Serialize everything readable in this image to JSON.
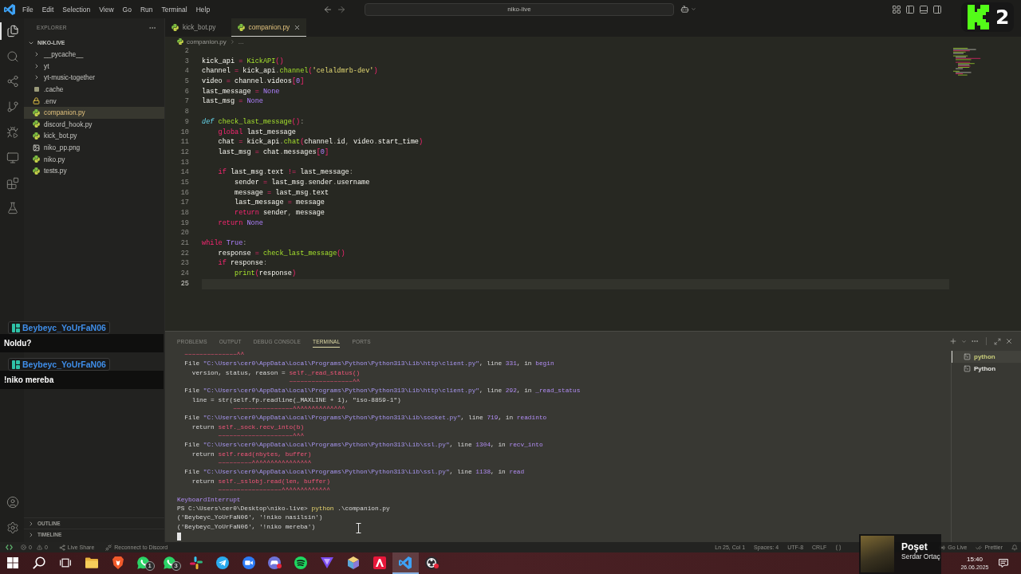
{
  "title_bar": {
    "menu": [
      "File",
      "Edit",
      "Selection",
      "View",
      "Go",
      "Run",
      "Terminal",
      "Help"
    ],
    "search": "niko-live"
  },
  "overlay_badge": {
    "count": "2"
  },
  "activity_bar": {
    "items": [
      {
        "kind": "files",
        "selected": true
      },
      {
        "kind": "search",
        "selected": false
      },
      {
        "kind": "share",
        "selected": false
      },
      {
        "kind": "branch",
        "selected": false
      },
      {
        "kind": "debug",
        "selected": false
      },
      {
        "kind": "remote",
        "selected": false
      },
      {
        "kind": "blocks",
        "selected": false
      },
      {
        "kind": "flask",
        "selected": false
      }
    ],
    "bottom": [
      {
        "kind": "account"
      },
      {
        "kind": "gear"
      }
    ]
  },
  "sidebar": {
    "title": "EXPLORER",
    "folder": "NIKO-LIVE",
    "items": [
      {
        "name": "__pycache__",
        "kind": "folder",
        "selected": false
      },
      {
        "name": "yt",
        "kind": "folder",
        "selected": false
      },
      {
        "name": "yt-music-together",
        "kind": "folder",
        "selected": false
      },
      {
        "name": ".cache",
        "kind": "cache",
        "selected": false
      },
      {
        "name": ".env",
        "kind": "lock",
        "selected": false
      },
      {
        "name": "companion.py",
        "kind": "python",
        "selected": true
      },
      {
        "name": "discord_hook.py",
        "kind": "python",
        "selected": false
      },
      {
        "name": "kick_bot.py",
        "kind": "python",
        "selected": false
      },
      {
        "name": "niko_pp.png",
        "kind": "image",
        "selected": false
      },
      {
        "name": "niko.py",
        "kind": "python",
        "selected": false
      },
      {
        "name": "tests.py",
        "kind": "python",
        "selected": false
      }
    ],
    "sections": [
      "OUTLINE",
      "TIMELINE"
    ]
  },
  "tabs": [
    {
      "label": "kick_bot.py",
      "selected": false
    },
    {
      "label": "companion.py",
      "selected": true
    }
  ],
  "breadcrumb": [
    "companion.py",
    "..."
  ],
  "editor": {
    "lines": [
      {
        "number": "2",
        "current": false
      },
      {
        "number": "3",
        "current": false,
        "tokens": [
          {
            "text": "kick_api ",
            "kind": "plain"
          },
          {
            "text": "= ",
            "kind": "kw"
          },
          {
            "text": "KickAPI",
            "kind": "fn"
          },
          {
            "text": "()",
            "kind": "kw"
          }
        ]
      },
      {
        "number": "4",
        "current": false,
        "tokens": [
          {
            "text": "channel ",
            "kind": "plain"
          },
          {
            "text": "= ",
            "kind": "kw"
          },
          {
            "text": "kick_api",
            "kind": "plain"
          },
          {
            "text": ".",
            "kind": "dim"
          },
          {
            "text": "channel",
            "kind": "fn"
          },
          {
            "text": "(",
            "kind": "kw"
          },
          {
            "text": "'celaldmrb-dev'",
            "kind": "str"
          },
          {
            "text": ")",
            "kind": "kw"
          }
        ]
      },
      {
        "number": "5",
        "current": false,
        "tokens": [
          {
            "text": "video ",
            "kind": "plain"
          },
          {
            "text": "= ",
            "kind": "kw"
          },
          {
            "text": "channel",
            "kind": "plain"
          },
          {
            "text": ".",
            "kind": "dim"
          },
          {
            "text": "videos",
            "kind": "plain"
          },
          {
            "text": "[",
            "kind": "kw"
          },
          {
            "text": "0",
            "kind": "const"
          },
          {
            "text": "]",
            "kind": "kw"
          }
        ]
      },
      {
        "number": "6",
        "current": false,
        "tokens": [
          {
            "text": "last_message ",
            "kind": "plain"
          },
          {
            "text": "= ",
            "kind": "kw"
          },
          {
            "text": "None",
            "kind": "const"
          }
        ]
      },
      {
        "number": "7",
        "current": false,
        "tokens": [
          {
            "text": "last_msg ",
            "kind": "plain"
          },
          {
            "text": "= ",
            "kind": "kw"
          },
          {
            "text": "None",
            "kind": "const"
          }
        ]
      },
      {
        "number": "8",
        "current": false
      },
      {
        "number": "9",
        "current": false,
        "tokens": [
          {
            "text": "def ",
            "kind": "def"
          },
          {
            "text": "check_last_message",
            "kind": "fn"
          },
          {
            "text": "()",
            "kind": "kw"
          },
          {
            "text": ":",
            "kind": "dim"
          }
        ]
      },
      {
        "number": "10",
        "current": false,
        "tokens": [
          {
            "text": "    global ",
            "kind": "kw"
          },
          {
            "text": "last_message",
            "kind": "plain"
          }
        ]
      },
      {
        "number": "11",
        "current": false,
        "tokens": [
          {
            "text": "    chat ",
            "kind": "plain"
          },
          {
            "text": "= ",
            "kind": "kw"
          },
          {
            "text": "kick_api",
            "kind": "plain"
          },
          {
            "text": ".",
            "kind": "dim"
          },
          {
            "text": "chat",
            "kind": "fn"
          },
          {
            "text": "(",
            "kind": "kw"
          },
          {
            "text": "channel",
            "kind": "plain"
          },
          {
            "text": ".",
            "kind": "dim"
          },
          {
            "text": "id",
            "kind": "plain"
          },
          {
            "text": ", ",
            "kind": "dim"
          },
          {
            "text": "video",
            "kind": "plain"
          },
          {
            "text": ".",
            "kind": "dim"
          },
          {
            "text": "start_time",
            "kind": "plain"
          },
          {
            "text": ")",
            "kind": "kw"
          }
        ]
      },
      {
        "number": "12",
        "current": false,
        "tokens": [
          {
            "text": "    last_msg ",
            "kind": "plain"
          },
          {
            "text": "= ",
            "kind": "kw"
          },
          {
            "text": "chat",
            "kind": "plain"
          },
          {
            "text": ".",
            "kind": "dim"
          },
          {
            "text": "messages",
            "kind": "plain"
          },
          {
            "text": "[",
            "kind": "kw"
          },
          {
            "text": "0",
            "kind": "const"
          },
          {
            "text": "]",
            "kind": "kw"
          }
        ]
      },
      {
        "number": "13",
        "current": false
      },
      {
        "number": "14",
        "current": false,
        "tokens": [
          {
            "text": "    if ",
            "kind": "kw"
          },
          {
            "text": "last_msg",
            "kind": "plain"
          },
          {
            "text": ".",
            "kind": "dim"
          },
          {
            "text": "text ",
            "kind": "plain"
          },
          {
            "text": "!= ",
            "kind": "kw"
          },
          {
            "text": "last_message",
            "kind": "plain"
          },
          {
            "text": ":",
            "kind": "dim"
          }
        ]
      },
      {
        "number": "15",
        "current": false,
        "tokens": [
          {
            "text": "        sender ",
            "kind": "plain"
          },
          {
            "text": "= ",
            "kind": "kw"
          },
          {
            "text": "last_msg",
            "kind": "plain"
          },
          {
            "text": ".",
            "kind": "dim"
          },
          {
            "text": "sender",
            "kind": "plain"
          },
          {
            "text": ".",
            "kind": "dim"
          },
          {
            "text": "username",
            "kind": "plain"
          }
        ]
      },
      {
        "number": "16",
        "current": false,
        "tokens": [
          {
            "text": "        message ",
            "kind": "plain"
          },
          {
            "text": "= ",
            "kind": "kw"
          },
          {
            "text": "last_msg",
            "kind": "plain"
          },
          {
            "text": ".",
            "kind": "dim"
          },
          {
            "text": "text",
            "kind": "plain"
          }
        ]
      },
      {
        "number": "17",
        "current": false,
        "tokens": [
          {
            "text": "        last_message ",
            "kind": "plain"
          },
          {
            "text": "= ",
            "kind": "kw"
          },
          {
            "text": "message",
            "kind": "plain"
          }
        ]
      },
      {
        "number": "18",
        "current": false,
        "tokens": [
          {
            "text": "        return ",
            "kind": "kw"
          },
          {
            "text": "sender",
            "kind": "plain"
          },
          {
            "text": ", ",
            "kind": "dim"
          },
          {
            "text": "message",
            "kind": "plain"
          }
        ]
      },
      {
        "number": "19",
        "current": false,
        "tokens": [
          {
            "text": "    return ",
            "kind": "kw"
          },
          {
            "text": "None",
            "kind": "const"
          }
        ]
      },
      {
        "number": "20",
        "current": false
      },
      {
        "number": "21",
        "current": false,
        "tokens": [
          {
            "text": "while ",
            "kind": "kw"
          },
          {
            "text": "True",
            "kind": "const"
          },
          {
            "text": ":",
            "kind": "dim"
          }
        ]
      },
      {
        "number": "22",
        "current": false,
        "tokens": [
          {
            "text": "    response ",
            "kind": "plain"
          },
          {
            "text": "= ",
            "kind": "kw"
          },
          {
            "text": "check_last_message",
            "kind": "fn"
          },
          {
            "text": "()",
            "kind": "kw"
          }
        ]
      },
      {
        "number": "23",
        "current": false,
        "tokens": [
          {
            "text": "    if ",
            "kind": "kw"
          },
          {
            "text": "response",
            "kind": "plain"
          },
          {
            "text": ":",
            "kind": "dim"
          }
        ]
      },
      {
        "number": "24",
        "current": false,
        "tokens": [
          {
            "text": "        print",
            "kind": "fn"
          },
          {
            "text": "(",
            "kind": "kw"
          },
          {
            "text": "response",
            "kind": "plain"
          },
          {
            "text": ")",
            "kind": "kw"
          }
        ]
      },
      {
        "number": "25",
        "current": true
      }
    ]
  },
  "panel": {
    "tabs": [
      {
        "label": "PROBLEMS",
        "selected": false
      },
      {
        "label": "OUTPUT",
        "selected": false
      },
      {
        "label": "DEBUG CONSOLE",
        "selected": false
      },
      {
        "label": "TERMINAL",
        "selected": true
      },
      {
        "label": "PORTS",
        "selected": false
      }
    ],
    "terminal": {
      "lines": [
        [
          {
            "text": "  ~~~~~~~~~~~~~~^^",
            "kind": "err"
          }
        ],
        [
          {
            "text": "  File ",
            "kind": "plain"
          },
          {
            "text": "\"C:\\Users\\cer0\\AppData\\Local\\Programs\\Python\\Python313\\Lib\\http\\client.py\"",
            "kind": "path"
          },
          {
            "text": ", line ",
            "kind": "plain"
          },
          {
            "text": "331",
            "kind": "name"
          },
          {
            "text": ", in ",
            "kind": "plain"
          },
          {
            "text": "begin",
            "kind": "name"
          }
        ],
        [
          {
            "text": "    version, status, reason = ",
            "kind": "plain"
          },
          {
            "text": "self._read_status()",
            "kind": "err"
          }
        ],
        [
          {
            "text": "                              ~~~~~~~~~~~~~~~~~^^",
            "kind": "err"
          }
        ],
        [
          {
            "text": "  File ",
            "kind": "plain"
          },
          {
            "text": "\"C:\\Users\\cer0\\AppData\\Local\\Programs\\Python\\Python313\\Lib\\http\\client.py\"",
            "kind": "path"
          },
          {
            "text": ", line ",
            "kind": "plain"
          },
          {
            "text": "292",
            "kind": "name"
          },
          {
            "text": ", in ",
            "kind": "plain"
          },
          {
            "text": "_read_status",
            "kind": "name"
          }
        ],
        [
          {
            "text": "    line = str(self.fp.readline(_MAXLINE + 1), \"iso-8859-1\")",
            "kind": "plain"
          }
        ],
        [
          {
            "text": "               ~~~~~~~~~~~~~~~~^^^^^^^^^^^^^^",
            "kind": "err"
          }
        ],
        [
          {
            "text": "  File ",
            "kind": "plain"
          },
          {
            "text": "\"C:\\Users\\cer0\\AppData\\Local\\Programs\\Python\\Python313\\Lib\\socket.py\"",
            "kind": "path"
          },
          {
            "text": ", line ",
            "kind": "plain"
          },
          {
            "text": "719",
            "kind": "name"
          },
          {
            "text": ", in ",
            "kind": "plain"
          },
          {
            "text": "readinto",
            "kind": "name"
          }
        ],
        [
          {
            "text": "    return ",
            "kind": "plain"
          },
          {
            "text": "self._sock.recv_into(b)",
            "kind": "err"
          }
        ],
        [
          {
            "text": "           ~~~~~~~~~~~~~~~~~~~~^^^",
            "kind": "err"
          }
        ],
        [
          {
            "text": "  File ",
            "kind": "plain"
          },
          {
            "text": "\"C:\\Users\\cer0\\AppData\\Local\\Programs\\Python\\Python313\\Lib\\ssl.py\"",
            "kind": "path"
          },
          {
            "text": ", line ",
            "kind": "plain"
          },
          {
            "text": "1304",
            "kind": "name"
          },
          {
            "text": ", in ",
            "kind": "plain"
          },
          {
            "text": "recv_into",
            "kind": "name"
          }
        ],
        [
          {
            "text": "    return ",
            "kind": "plain"
          },
          {
            "text": "self.read(nbytes, buffer)",
            "kind": "err"
          }
        ],
        [
          {
            "text": "           ~~~~~~~~~^^^^^^^^^^^^^^^^",
            "kind": "err"
          }
        ],
        [
          {
            "text": "  File ",
            "kind": "plain"
          },
          {
            "text": "\"C:\\Users\\cer0\\AppData\\Local\\Programs\\Python\\Python313\\Lib\\ssl.py\"",
            "kind": "path"
          },
          {
            "text": ", line ",
            "kind": "plain"
          },
          {
            "text": "1138",
            "kind": "name"
          },
          {
            "text": ", in ",
            "kind": "plain"
          },
          {
            "text": "read",
            "kind": "name"
          }
        ],
        [
          {
            "text": "    return ",
            "kind": "plain"
          },
          {
            "text": "self._sslobj.read(len, buffer)",
            "kind": "err"
          }
        ],
        [
          {
            "text": "           ~~~~~~~~~~~~~~~~~^^^^^^^^^^^^^",
            "kind": "err"
          }
        ],
        [
          {
            "text": "KeyboardInterrupt",
            "kind": "name"
          }
        ],
        [
          {
            "text": "PS C:\\Users\\cer0\\Desktop\\niko-live> ",
            "kind": "plain"
          },
          {
            "text": "python",
            "kind": "cmd"
          },
          {
            "text": " .\\companion.py",
            "kind": "plain"
          }
        ],
        [
          {
            "text": "('Beybeyc_YoUrFaN06', '!niko nasilsin')",
            "kind": "plain"
          }
        ],
        [
          {
            "text": "('Beybeyc_YoUrFaN06', '!niko mereba')",
            "kind": "plain"
          }
        ]
      ]
    },
    "sessions": [
      {
        "label": "python",
        "selected": true
      },
      {
        "label": "Python",
        "selected": false
      }
    ]
  },
  "chat_overlay": {
    "messages": [
      {
        "user": "Beybeyc_YoUrFaN06",
        "text": "Noldu?"
      },
      {
        "user": "Beybeyc_YoUrFaN06",
        "text": "!niko mereba"
      }
    ]
  },
  "status_bar": {
    "errors": "0",
    "warnings": "0",
    "left": [
      {
        "label": "Live Share",
        "kind": "share"
      },
      {
        "label": "Reconnect to Discord",
        "kind": "plug"
      }
    ],
    "right": [
      "Ln 25, Col 1",
      "Spaces: 4",
      "UTF-8",
      "CRLF"
    ],
    "extras": [
      {
        "label": "Go Live",
        "kind": "broadcast"
      },
      {
        "label": "Prettier",
        "kind": "checks"
      }
    ]
  },
  "now_playing": {
    "title": "Poşet",
    "artist": "Serdar Ortaç"
  },
  "taskbar": {
    "apps": [
      {
        "kind": "start",
        "selected": false,
        "alert": false
      },
      {
        "kind": "search",
        "selected": false,
        "alert": false
      },
      {
        "kind": "taskview",
        "selected": false,
        "alert": false
      },
      {
        "kind": "folder",
        "selected": false,
        "alert": false
      },
      {
        "kind": "shield",
        "selected": false,
        "alert": false
      },
      {
        "kind": "chat",
        "selected": false,
        "alert": false,
        "badge": "1"
      },
      {
        "kind": "chat",
        "selected": false,
        "alert": false,
        "badge": "3"
      },
      {
        "kind": "pinwheel",
        "selected": false,
        "alert": false
      },
      {
        "kind": "plane",
        "selected": false,
        "alert": false
      },
      {
        "kind": "camera",
        "selected": false,
        "alert": false
      },
      {
        "kind": "gamepad",
        "selected": false,
        "alert": true
      },
      {
        "kind": "waves",
        "selected": false,
        "alert": false
      },
      {
        "kind": "triangle",
        "selected": false,
        "alert": false
      },
      {
        "kind": "cube",
        "selected": false,
        "alert": false
      },
      {
        "kind": "peak",
        "selected": false,
        "alert": false
      },
      {
        "kind": "ribbon",
        "selected": true,
        "alert": false
      },
      {
        "kind": "ring",
        "selected": false,
        "alert": true
      }
    ],
    "time": "15:40",
    "date": "26.06.2025"
  }
}
